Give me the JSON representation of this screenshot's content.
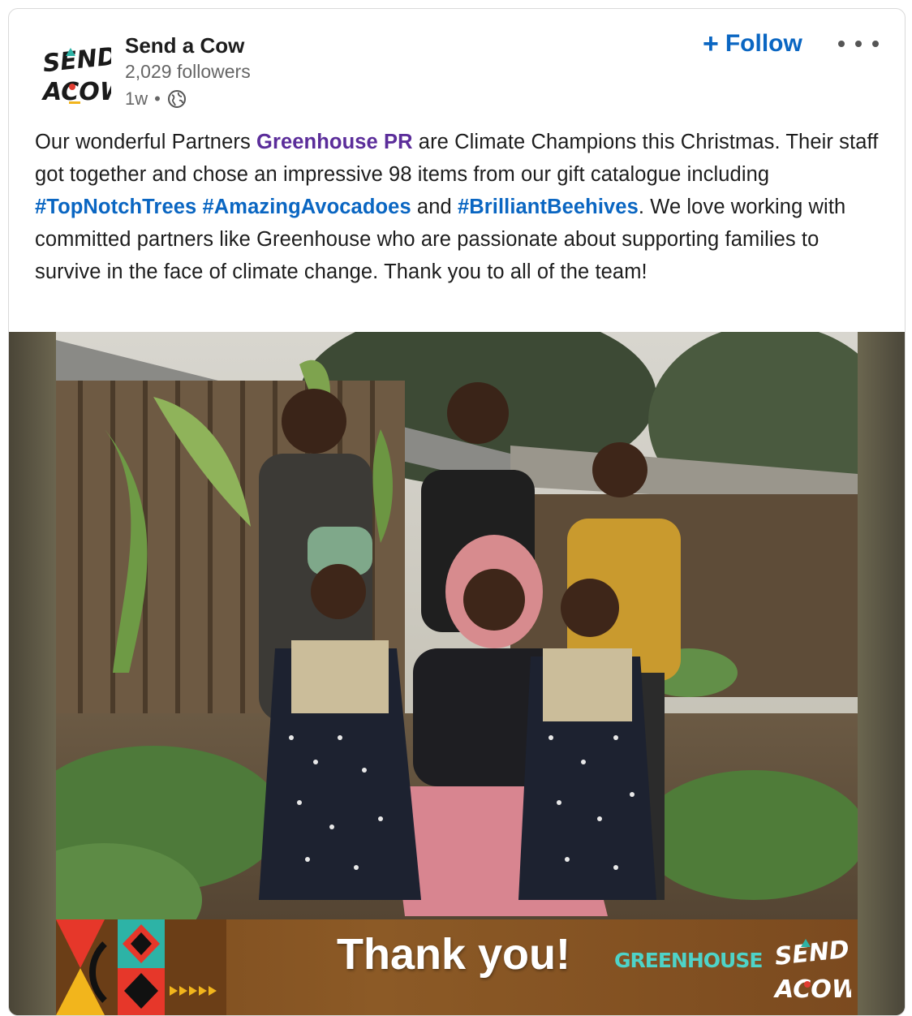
{
  "author": {
    "name": "Send a Cow",
    "followers": "2,029 followers",
    "time": "1w",
    "separator": "•",
    "visibility_icon": "globe-icon",
    "logo_text": [
      "SEND",
      "A COW"
    ]
  },
  "actions": {
    "follow_plus": "+",
    "follow_label": "Follow",
    "more_icon": "more-options-icon"
  },
  "post": {
    "segments": [
      {
        "text": "Our wonderful Partners ",
        "type": "text"
      },
      {
        "text": "Greenhouse PR",
        "type": "mention"
      },
      {
        "text": " are Climate Champions this Christmas. Their staff got together and chose an impressive 98 items from our gift catalogue including ",
        "type": "text"
      },
      {
        "text": "#TopNotchTrees",
        "type": "hashtag"
      },
      {
        "text": " ",
        "type": "text"
      },
      {
        "text": "#AmazingAvocadoes",
        "type": "hashtag"
      },
      {
        "text": " and ",
        "type": "text"
      },
      {
        "text": "#BrilliantBeehives",
        "type": "hashtag"
      },
      {
        "text": ". We love working with committed partners like Greenhouse who are passionate about supporting families to survive in the face of climate change. Thank you to all of the team!",
        "type": "text"
      }
    ]
  },
  "media": {
    "banner_text": "Thank you!",
    "partner_logo": "GREENHOUSE",
    "banner_logo_text": [
      "SEND",
      "A COW"
    ]
  },
  "colors": {
    "link_blue": "#0a66c2",
    "mention_purple": "#5b2d9a",
    "text": "#1d1d1d",
    "muted": "#666666"
  }
}
